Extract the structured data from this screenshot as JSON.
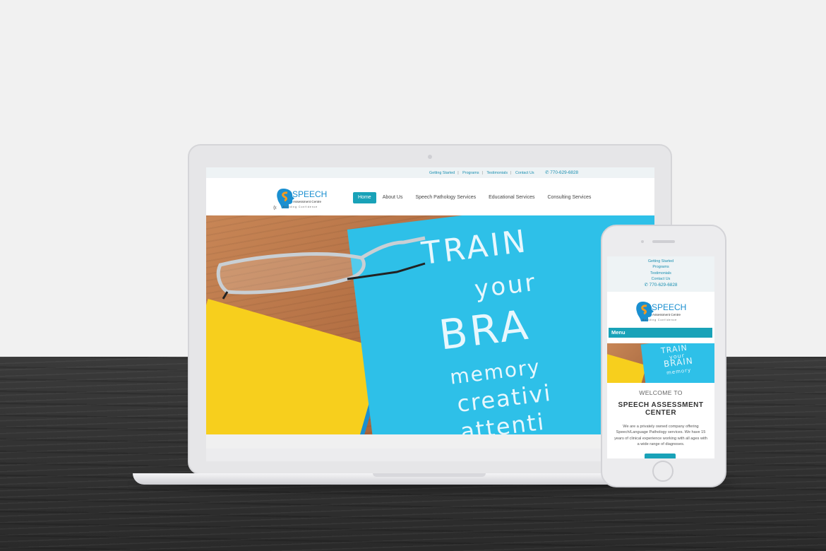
{
  "laptop_site": {
    "top_links": [
      "Getting Started",
      "Programs",
      "Testimonials",
      "Contact Us"
    ],
    "phone": "770-629-6828",
    "logo": {
      "name": "SPEECH",
      "sub": "Assessment Centre",
      "tagline": "Building Confidence"
    },
    "nav": [
      {
        "label": "Home",
        "active": true
      },
      {
        "label": "About Us",
        "active": false
      },
      {
        "label": "Speech Pathology Services",
        "active": false
      },
      {
        "label": "Educational Services",
        "active": false
      },
      {
        "label": "Consulting Services",
        "active": false
      }
    ],
    "hero_text": [
      "TRAIN",
      "your",
      "BRA",
      "memory",
      "creativi",
      "attenti"
    ]
  },
  "mobile_site": {
    "top_links": [
      "Getting Started",
      "Programs",
      "Testimonials",
      "Contact Us"
    ],
    "phone": "770-629-6828",
    "menu_label": "Menu",
    "hero_text": [
      "TRAIN",
      "your",
      "BRAIN",
      "memory"
    ],
    "welcome": "WELCOME TO",
    "title": "SPEECH ASSESSMENT CENTER",
    "description": "We are a privately owned company offering Speech/Language Pathology services. We have 15 years of clinical experience working with all ages with a wide range of diagnoses."
  },
  "colors": {
    "accent": "#19a2b8",
    "link": "#1a8fb0",
    "card_blue": "#2ec0e8",
    "card_yellow": "#f7cf1d"
  }
}
